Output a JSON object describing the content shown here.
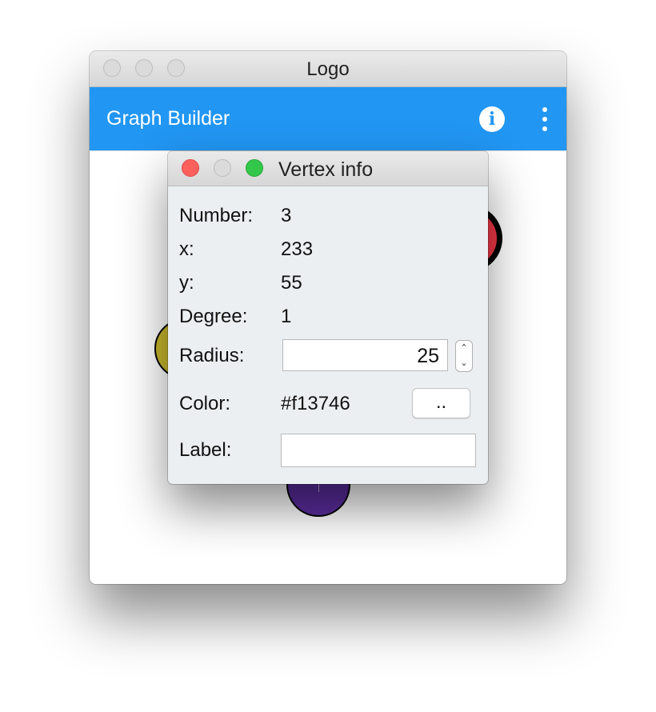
{
  "main_window": {
    "title": "Logo"
  },
  "app_bar": {
    "title": "Graph Builder",
    "info_icon": "i",
    "more_icon": "more-vertical-icon",
    "color": "#2196f3"
  },
  "vertex_colors": {
    "red": "#f13746",
    "yellow": "#c9b82c",
    "purple": "#5b2d9e"
  },
  "dialog": {
    "title": "Vertex info",
    "number_label": "Number:",
    "number_value": "3",
    "x_label": "x:",
    "x_value": "233",
    "y_label": "y:",
    "y_value": "55",
    "degree_label": "Degree:",
    "degree_value": "1",
    "radius_label": "Radius:",
    "radius_value": "25",
    "color_label": "Color:",
    "color_value": "#f13746",
    "color_button_label": "..",
    "label_label": "Label:",
    "label_value": ""
  }
}
